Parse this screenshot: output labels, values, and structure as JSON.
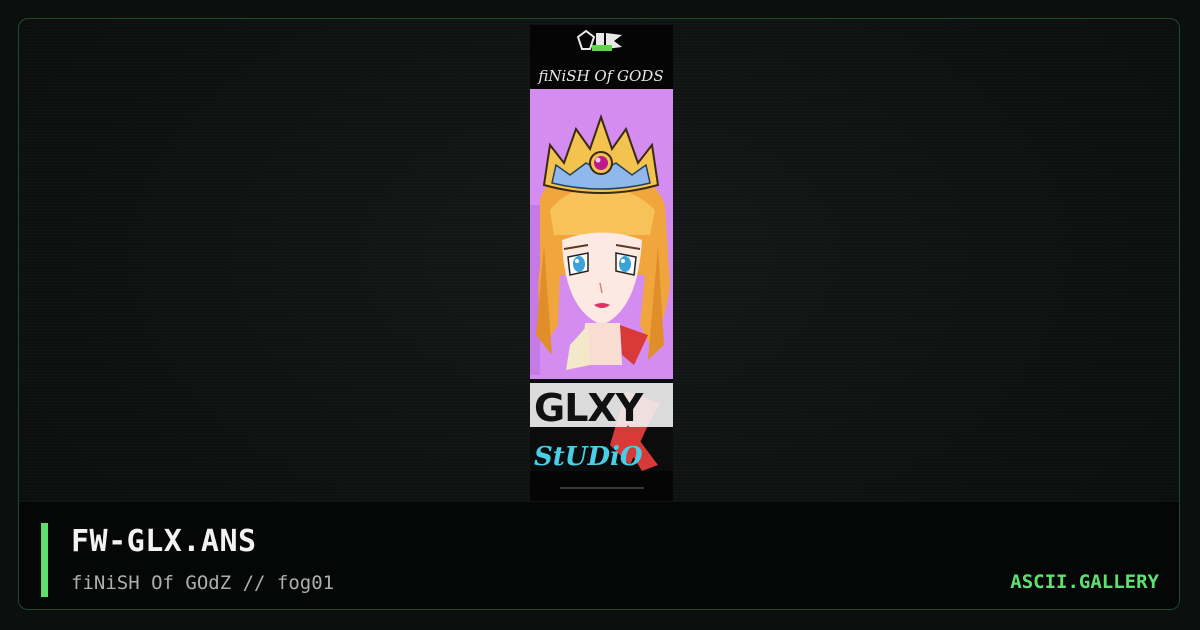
{
  "artwork": {
    "file_name": "FW-GLX.ANS",
    "credit_line": "fiNiSH Of GOdZ // fog01",
    "alt": "ANSI art: princess portrait with crown",
    "header_logo_text": "fiNiSH Of GODS",
    "bottom_logo_text": "GLXY",
    "bottom_logo_subtext": "StUDiO"
  },
  "site": {
    "name": "ASCII.GALLERY"
  },
  "colors": {
    "accent": "#5ee06f",
    "background": "#0b0f0e",
    "frame_border": "#1f4a2a",
    "title": "#f2f2f2",
    "subtitle": "#a9b0ad"
  }
}
